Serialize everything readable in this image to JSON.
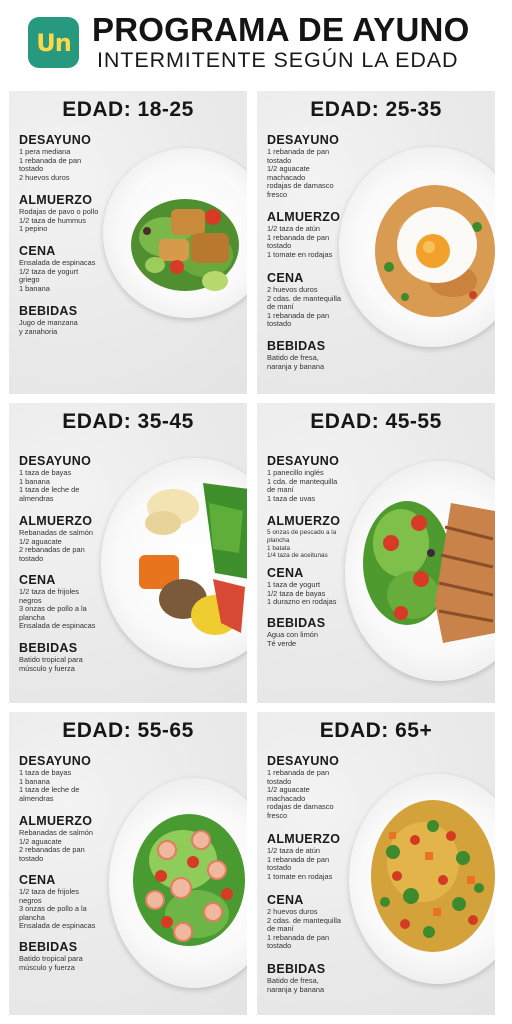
{
  "header": {
    "logo_text": "Un",
    "brand_color": "#27997f",
    "logo_accent": "#ffd84a",
    "title": "PROGRAMA DE AYUNO",
    "subtitle": "INTERMITENTE SEGÚN LA EDAD"
  },
  "cards": [
    {
      "title": "EDAD: 18-25",
      "sections": [
        {
          "heading": "DESAYUNO",
          "text": "1 pera mediana\n1 rebanada de pan\ntostado\n2 huevos duros"
        },
        {
          "heading": "ALMUERZO",
          "text": "Rodajas de pavo o pollo\n1/2 taza de hummus\n1 pepino"
        },
        {
          "heading": "CENA",
          "text": "Ensalada de espinacas\n1/2 taza de yogurt\ngriego\n1 banana"
        },
        {
          "heading": "BEBIDAS",
          "text": "Jugo de manzana\ny zanahoria"
        }
      ],
      "food_icon": "chicken-salad-plate"
    },
    {
      "title": "EDAD: 25-35",
      "sections": [
        {
          "heading": "DESAYUNO",
          "text": "1 rebanada de pan\ntostado\n1/2 aguacate\nmachacado\nrodajas de damasco\nfresco"
        },
        {
          "heading": "ALMUERZO",
          "text": "1/2 taza de atún\n1 rebanada de pan\ntostado\n1 tomate en rodajas"
        },
        {
          "heading": "CENA",
          "text": "2 huevos duros\n2 cdas. de mantequilla\nde maní\n1 rebanada de pan\ntostado"
        },
        {
          "heading": "BEBIDAS",
          "text": "Batido de fresa,\nnaranja y banana"
        }
      ],
      "food_icon": "fried-egg-rice-plate"
    },
    {
      "title": "EDAD: 35-45",
      "sections": [
        {
          "heading": "DESAYUNO",
          "text": "1 taza de bayas\n1 banana\n1 taza de leche de\nalmendras"
        },
        {
          "heading": "ALMUERZO",
          "text": "Rebanadas de salmón\n1/2 aguacate\n2 rebanadas de pan\ntostado"
        },
        {
          "heading": "CENA",
          "text": "1/2 taza de frijoles\nnegros\n3 onzas de pollo a la\nplancha\nEnsalada de espinacas"
        },
        {
          "heading": "BEBIDAS",
          "text": "Batido tropical para\nmúsculo y fuerza"
        }
      ],
      "food_icon": "mixed-bowl-plate"
    },
    {
      "title": "EDAD: 45-55",
      "sections": [
        {
          "heading": "DESAYUNO",
          "text": "1 panecillo inglés\n1 cda. de mantequilla\nde maní\n1 taza de uvas"
        },
        {
          "heading": "ALMUERZO",
          "text": "5 onzas de pescado a la\nplancha\n1 batata\n1/4 taza de aceitunas"
        },
        {
          "heading": "CENA",
          "text": "1 taza de yogurt\n1/2 taza de bayas\n1 durazno en rodajas"
        },
        {
          "heading": "BEBIDAS",
          "text": "Agua con limón\nTé verde"
        }
      ],
      "food_icon": "grilled-chicken-salad-plate"
    },
    {
      "title": "EDAD: 55-65",
      "sections": [
        {
          "heading": "DESAYUNO",
          "text": "1 taza de bayas\n1 banana\n1 taza de leche de\nalmendras"
        },
        {
          "heading": "ALMUERZO",
          "text": "Rebanadas de salmón\n1/2 aguacate\n2 rebanadas de pan\ntostado"
        },
        {
          "heading": "CENA",
          "text": "1/2 taza de frijoles\nnegros\n3 onzas de pollo a la\nplancha\nEnsalada de espinacas"
        },
        {
          "heading": "BEBIDAS",
          "text": "Batido tropical para\nmúsculo y fuerza"
        }
      ],
      "food_icon": "shrimp-salad-plate"
    },
    {
      "title": "EDAD: 65+",
      "sections": [
        {
          "heading": "DESAYUNO",
          "text": "1 rebanada de pan\ntostado\n1/2 aguacate\nmachacado\nrodajas de damasco\nfresco"
        },
        {
          "heading": "ALMUERZO",
          "text": "1/2 taza de atún\n1 rebanada de pan\ntostado\n1 tomate en rodajas"
        },
        {
          "heading": "CENA",
          "text": "2 huevos duros\n2 cdas. de mantequilla\nde maní\n1 rebanada de pan\ntostado"
        },
        {
          "heading": "BEBIDAS",
          "text": "Batido de fresa,\nnaranja y banana"
        }
      ],
      "food_icon": "veggie-rice-plate"
    }
  ]
}
